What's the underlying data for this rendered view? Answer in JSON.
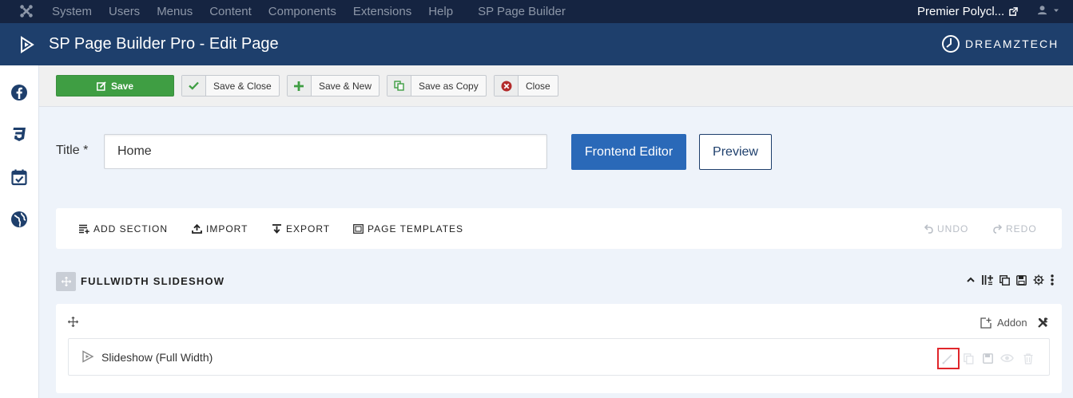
{
  "topbar": {
    "menu": [
      "System",
      "Users",
      "Menus",
      "Content",
      "Components",
      "Extensions",
      "Help"
    ],
    "extra": "SP Page Builder",
    "site_name": "Premier Polycl..."
  },
  "header": {
    "title": "SP Page Builder Pro - Edit Page",
    "brand": "DREAMZTECH"
  },
  "sidebar": {
    "icons": [
      "facebook-icon",
      "css3-icon",
      "calendar-check-icon",
      "globe-icon"
    ]
  },
  "toolbar": {
    "save": "Save",
    "save_close": "Save & Close",
    "save_new": "Save & New",
    "save_copy": "Save as Copy",
    "close": "Close"
  },
  "form": {
    "title_label": "Title *",
    "title_value": "Home",
    "frontend_editor": "Frontend Editor",
    "preview": "Preview"
  },
  "builder": {
    "add_section": "ADD SECTION",
    "import": "IMPORT",
    "export": "EXPORT",
    "page_templates": "PAGE TEMPLATES",
    "undo": "UNDO",
    "redo": "REDO"
  },
  "section": {
    "title": "FULLWIDTH SLIDESHOW",
    "addon_label": "Addon",
    "addon_name": "Slideshow (Full Width)"
  },
  "colors": {
    "topbar": "#152441",
    "header": "#1e3f6c",
    "save": "#3f9e43",
    "primary": "#2a69b8",
    "highlight": "#e0262b"
  }
}
